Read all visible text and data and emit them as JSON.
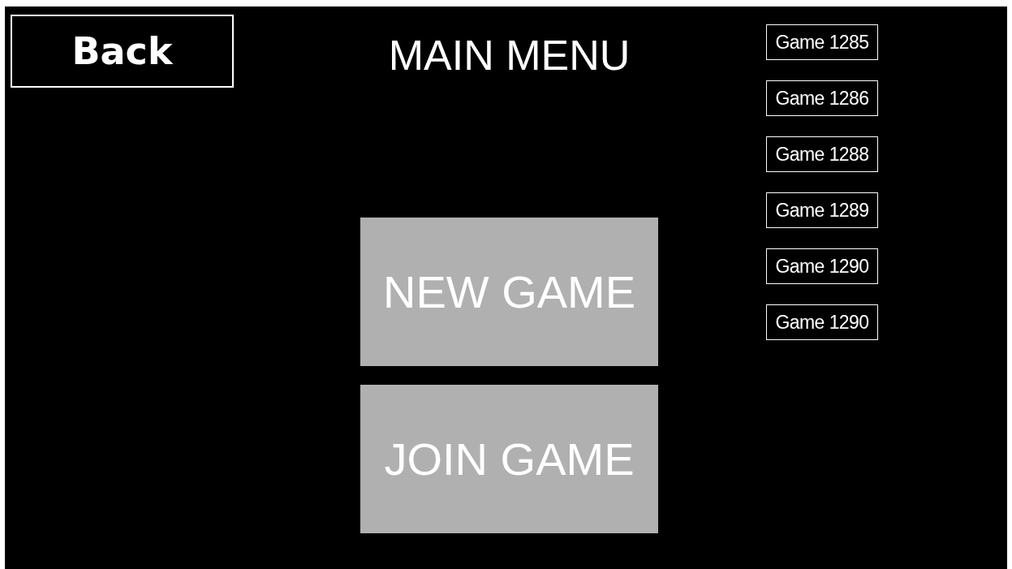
{
  "back_button": "Back",
  "title": "MAIN MENU",
  "menu_buttons": [
    "NEW GAME",
    "JOIN GAME"
  ],
  "games": [
    "Game 1285",
    "Game 1286",
    "Game 1288",
    "Game 1289",
    "Game 1290",
    "Game 1290"
  ]
}
